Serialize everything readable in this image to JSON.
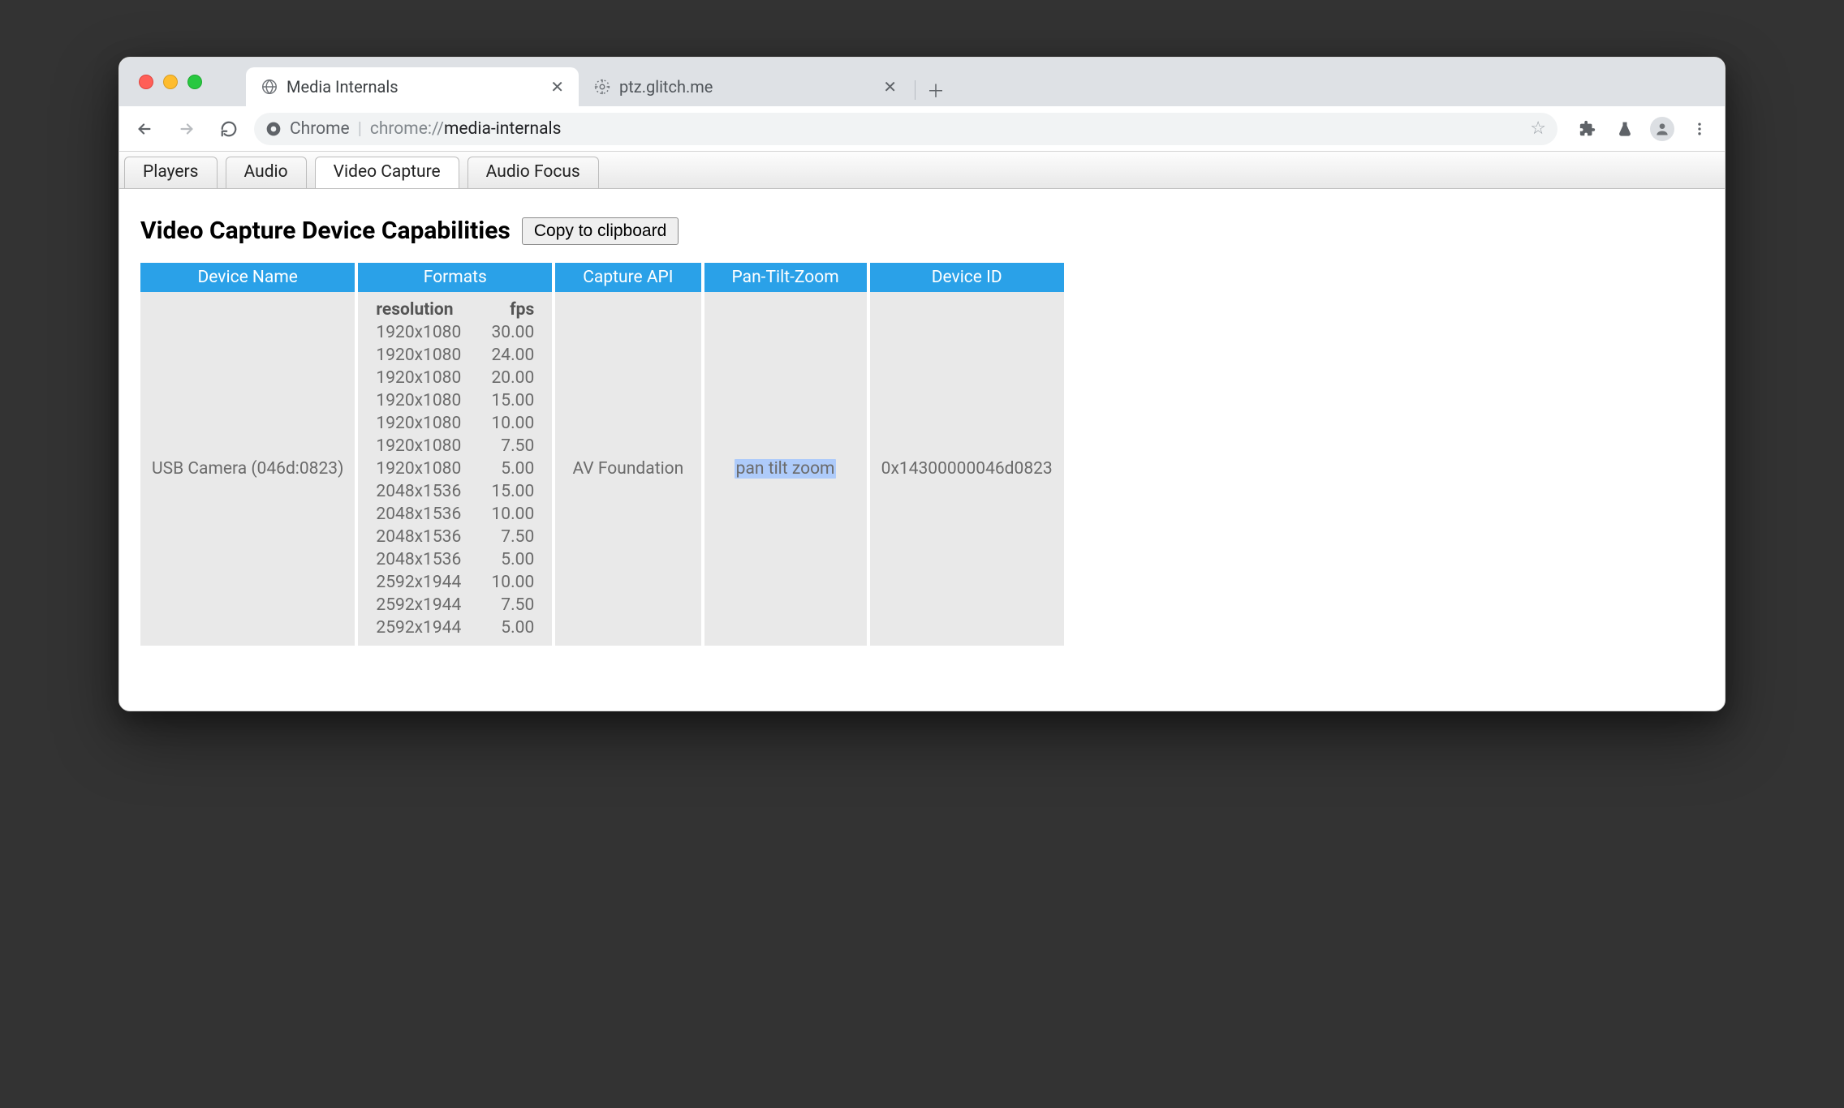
{
  "browser": {
    "tabs": [
      {
        "title": "Media Internals",
        "active": true,
        "favicon": "globe"
      },
      {
        "title": "ptz.glitch.me",
        "active": false,
        "favicon": "crosshair"
      }
    ],
    "omnibox": {
      "origin_label": "Chrome",
      "scheme": "chrome://",
      "path": "media-internals"
    }
  },
  "subtabs": [
    "Players",
    "Audio",
    "Video Capture",
    "Audio Focus"
  ],
  "active_subtab": 2,
  "heading": "Video Capture Device Capabilities",
  "copy_button": "Copy to clipboard",
  "table": {
    "columns": [
      "Device Name",
      "Formats",
      "Capture API",
      "Pan-Tilt-Zoom",
      "Device ID"
    ],
    "formats_header": {
      "resolution": "resolution",
      "fps": "fps"
    },
    "rows": [
      {
        "device_name": "USB Camera (046d:0823)",
        "capture_api": "AV Foundation",
        "ptz": "pan tilt zoom",
        "device_id": "0x14300000046d0823",
        "formats": [
          {
            "resolution": "1920x1080",
            "fps": "30.00"
          },
          {
            "resolution": "1920x1080",
            "fps": "24.00"
          },
          {
            "resolution": "1920x1080",
            "fps": "20.00"
          },
          {
            "resolution": "1920x1080",
            "fps": "15.00"
          },
          {
            "resolution": "1920x1080",
            "fps": "10.00"
          },
          {
            "resolution": "1920x1080",
            "fps": "7.50"
          },
          {
            "resolution": "1920x1080",
            "fps": "5.00"
          },
          {
            "resolution": "2048x1536",
            "fps": "15.00"
          },
          {
            "resolution": "2048x1536",
            "fps": "10.00"
          },
          {
            "resolution": "2048x1536",
            "fps": "7.50"
          },
          {
            "resolution": "2048x1536",
            "fps": "5.00"
          },
          {
            "resolution": "2592x1944",
            "fps": "10.00"
          },
          {
            "resolution": "2592x1944",
            "fps": "7.50"
          },
          {
            "resolution": "2592x1944",
            "fps": "5.00"
          }
        ]
      }
    ]
  }
}
